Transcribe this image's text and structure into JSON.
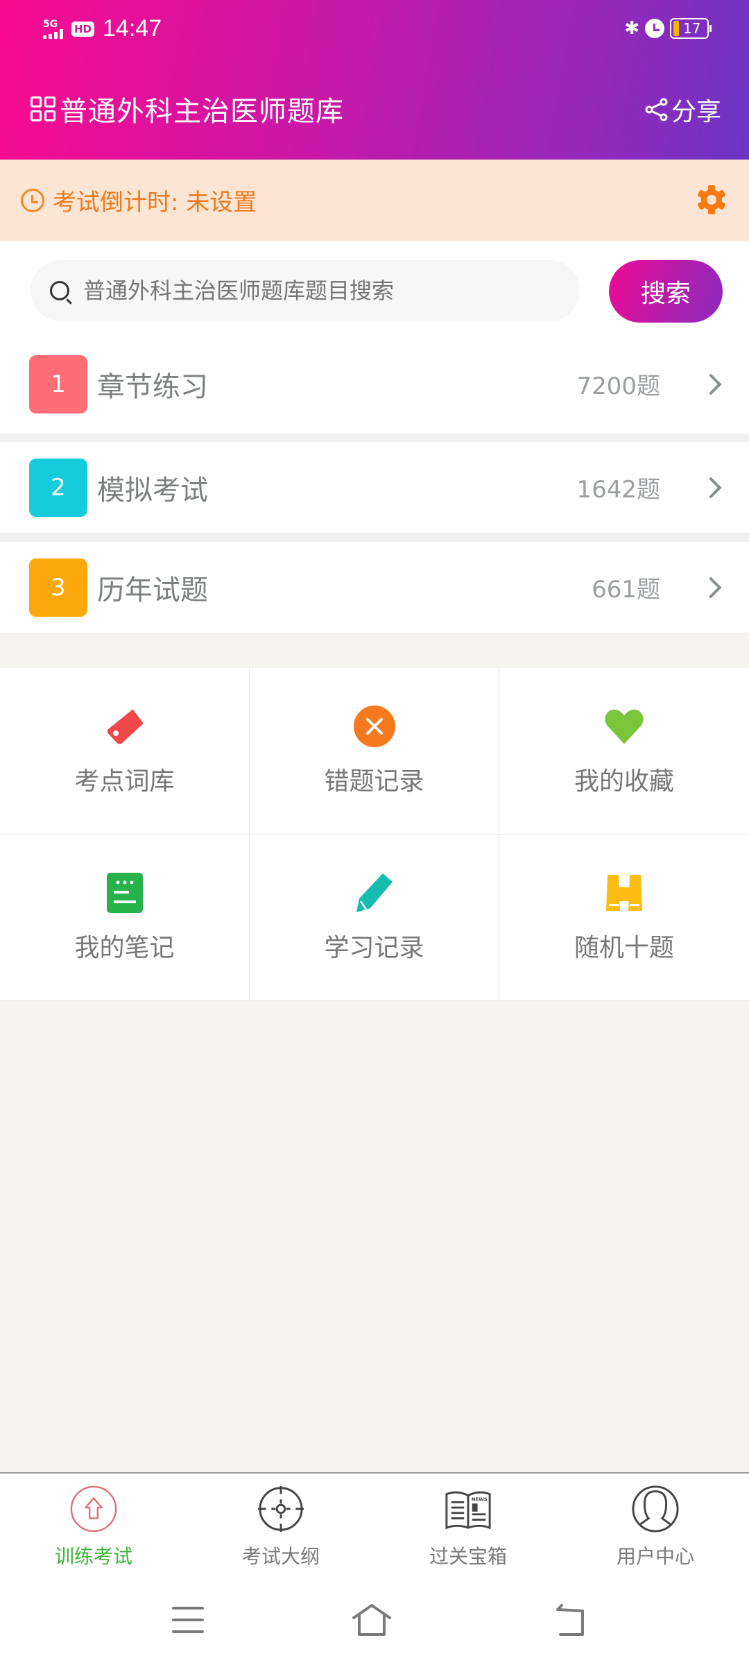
{
  "status_bar": {
    "network": "5G",
    "hd_label": "HD",
    "time": "14:47",
    "battery_level": "17",
    "icons": [
      "signal-icon",
      "bluetooth-icon",
      "alarm-icon",
      "battery-icon"
    ]
  },
  "header": {
    "title": "普通外科主治医师题库",
    "share_label": "分享",
    "icons": [
      "grid-icon",
      "share-icon"
    ]
  },
  "countdown": {
    "text": "考试倒计时: 未设置",
    "icons": [
      "clock-icon",
      "gear-icon"
    ]
  },
  "search": {
    "placeholder": "普通外科主治医师题库题目搜索",
    "value": "",
    "button_label": "搜索"
  },
  "sections": [
    {
      "index": "1",
      "label": "章节练习",
      "count": "7200题",
      "color": "#fd6d76"
    },
    {
      "index": "2",
      "label": "模拟考试",
      "count": "1642题",
      "color": "#16cbdc"
    },
    {
      "index": "3",
      "label": "历年试题",
      "count": "661题",
      "color": "#fda80a"
    }
  ],
  "features": [
    {
      "label": "考点词库",
      "icon": "tag-icon",
      "color": "#f04848"
    },
    {
      "label": "错题记录",
      "icon": "close-circle-icon",
      "color": "#f57a1f"
    },
    {
      "label": "我的收藏",
      "icon": "heart-icon",
      "color": "#7ac63a"
    },
    {
      "label": "我的笔记",
      "icon": "note-icon",
      "color": "#27b24a"
    },
    {
      "label": "学习记录",
      "icon": "pencil-icon",
      "color": "#16bcb0"
    },
    {
      "label": "随机十题",
      "icon": "binoculars-icon",
      "color": "#fbbd12"
    }
  ],
  "tabbar": {
    "tabs": [
      {
        "label": "训练考试",
        "icon": "home-icon",
        "active": true
      },
      {
        "label": "考试大纲",
        "icon": "target-icon",
        "active": false
      },
      {
        "label": "过关宝箱",
        "icon": "news-icon",
        "active": false
      },
      {
        "label": "用户中心",
        "icon": "user-icon",
        "active": false
      }
    ],
    "active_color": "#3fb53a"
  },
  "system_nav": [
    "menu-icon",
    "home-icon",
    "back-icon"
  ]
}
